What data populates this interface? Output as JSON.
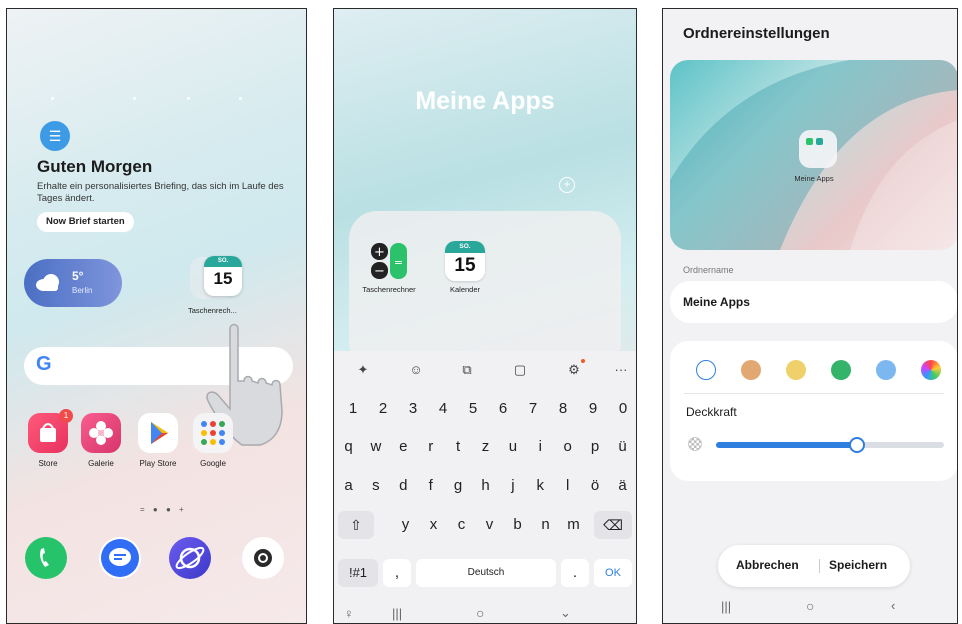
{
  "screen1": {
    "briefing": {
      "title": "Guten Morgen",
      "text": "Erhalte ein personalisiertes Briefing, das sich im Laufe des Tages ändert.",
      "button": "Now Brief starten"
    },
    "weather": {
      "temp": "5°",
      "city": "Berlin"
    },
    "folder_label": "Taschenrech...",
    "calendar_badge": {
      "day": "SO.",
      "date": "15"
    },
    "apps": [
      {
        "label": "Store",
        "badge": "1"
      },
      {
        "label": "Galerie"
      },
      {
        "label": "Play Store"
      },
      {
        "label": "Google"
      }
    ],
    "page_indicator": "= ● ● +"
  },
  "screen2": {
    "folder_title": "Meine Apps",
    "folder_apps": [
      {
        "label": "Taschenrechner"
      },
      {
        "label": "Kalender",
        "day": "SO.",
        "date": "15"
      }
    ],
    "keyboard": {
      "row_numbers": [
        "1",
        "2",
        "3",
        "4",
        "5",
        "6",
        "7",
        "8",
        "9",
        "0"
      ],
      "row1": [
        "q",
        "w",
        "e",
        "r",
        "t",
        "z",
        "u",
        "i",
        "o",
        "p",
        "ü"
      ],
      "row2": [
        "a",
        "s",
        "d",
        "f",
        "g",
        "h",
        "j",
        "k",
        "l",
        "ö",
        "ä"
      ],
      "row3": [
        "y",
        "x",
        "c",
        "v",
        "b",
        "n",
        "m"
      ],
      "symbols_key": "!#1",
      "comma_key": ",",
      "space_label": "Deutsch",
      "period_key": ".",
      "ok_key": "OK"
    }
  },
  "screen3": {
    "title": "Ordnereinstellungen",
    "preview_label": "Meine Apps",
    "name_caption": "Ordnername",
    "name_value": "Meine Apps",
    "opacity_label": "Deckkraft",
    "opacity_value": 0.62,
    "colors": [
      "#ffffff",
      "#e2a872",
      "#f0d06a",
      "#34b36a",
      "#7cb7ef",
      "rainbow"
    ],
    "selected_color": "#ffffff",
    "cancel": "Abbrechen",
    "save": "Speichern"
  },
  "accent_color": "#2f7fe0"
}
